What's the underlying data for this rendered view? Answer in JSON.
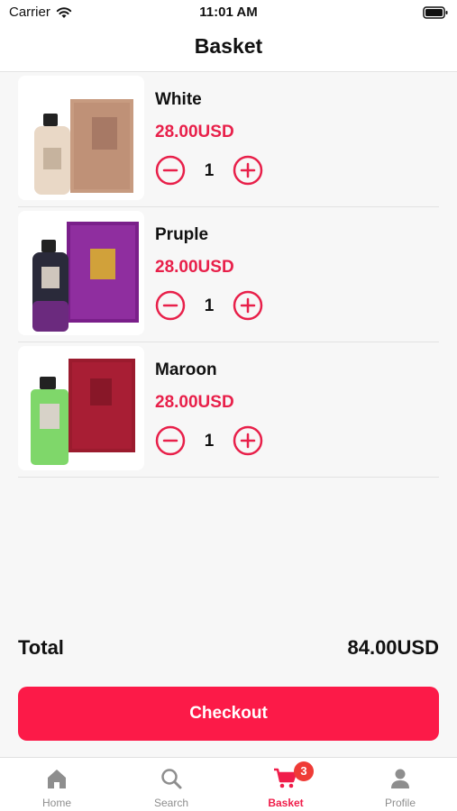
{
  "status_bar": {
    "carrier": "Carrier",
    "time": "11:01 AM"
  },
  "header": {
    "title": "Basket"
  },
  "items": [
    {
      "name": "White",
      "price": "28.00USD",
      "quantity": "1"
    },
    {
      "name": "Pruple",
      "price": "28.00USD",
      "quantity": "1"
    },
    {
      "name": "Maroon",
      "price": "28.00USD",
      "quantity": "1"
    }
  ],
  "summary": {
    "total_label": "Total",
    "total_amount": "84.00USD"
  },
  "checkout": {
    "label": "Checkout"
  },
  "tabs": [
    {
      "label": "Home",
      "icon": "home-icon"
    },
    {
      "label": "Search",
      "icon": "search-icon"
    },
    {
      "label": "Basket",
      "icon": "cart-icon",
      "badge": "3",
      "active": true
    },
    {
      "label": "Profile",
      "icon": "person-icon"
    }
  ],
  "colors": {
    "accent": "#fc1a48",
    "price": "#e8204a",
    "badge": "#ef3b36",
    "background": "#f7f7f7"
  }
}
